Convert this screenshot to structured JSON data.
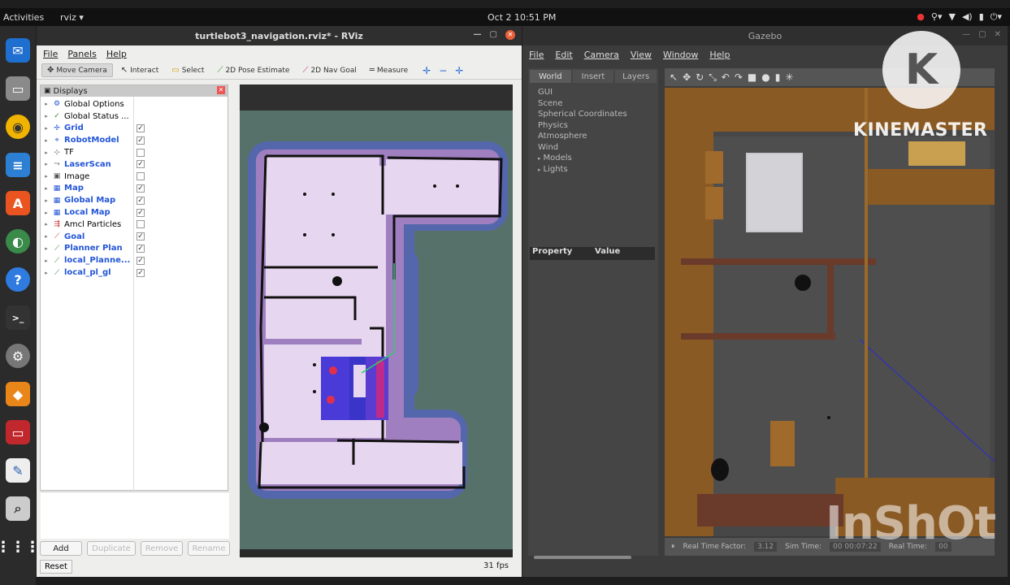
{
  "topbar": {
    "activities": "Activities",
    "app_menu": "rviz ▾",
    "clock": "Oct 2  10:51 PM"
  },
  "dock": {
    "items": [
      {
        "name": "thunderbird"
      },
      {
        "name": "files"
      },
      {
        "name": "rhythmbox"
      },
      {
        "name": "libreoffice-writer"
      },
      {
        "name": "software-center"
      },
      {
        "name": "chromium"
      },
      {
        "name": "help"
      },
      {
        "name": "terminal"
      },
      {
        "name": "settings"
      },
      {
        "name": "layers-app"
      },
      {
        "name": "system-monitor"
      },
      {
        "name": "text-editor"
      },
      {
        "name": "image-viewer"
      },
      {
        "name": "show-applications"
      }
    ]
  },
  "rviz": {
    "title": "turtlebot3_navigation.rviz* - RViz",
    "menu": [
      "File",
      "Panels",
      "Help"
    ],
    "toolbar": [
      "Move Camera",
      "Interact",
      "Select",
      "2D Pose Estimate",
      "2D Nav Goal",
      "Measure"
    ],
    "panel_title": "Displays",
    "displays": [
      {
        "label": "Global Options",
        "icon": "gear",
        "checked": null,
        "blue": false,
        "color": "#2255d8"
      },
      {
        "label": "Global Status ...",
        "icon": "check",
        "checked": null,
        "blue": false,
        "color": "#3a8a2a"
      },
      {
        "label": "Grid",
        "icon": "grid",
        "checked": true,
        "blue": true,
        "color": "#2255d8"
      },
      {
        "label": "RobotModel",
        "icon": "robot",
        "checked": true,
        "blue": true,
        "color": "#2255d8"
      },
      {
        "label": "TF",
        "icon": "tf",
        "checked": false,
        "blue": false,
        "color": "#555"
      },
      {
        "label": "LaserScan",
        "icon": "laser",
        "checked": true,
        "blue": true,
        "color": "#555"
      },
      {
        "label": "Image",
        "icon": "image",
        "checked": false,
        "blue": false,
        "color": "#555"
      },
      {
        "label": "Map",
        "icon": "map",
        "checked": true,
        "blue": true,
        "color": "#2255d8"
      },
      {
        "label": "Global Map",
        "icon": "map",
        "checked": true,
        "blue": true,
        "color": "#2255d8"
      },
      {
        "label": "Local Map",
        "icon": "map",
        "checked": true,
        "blue": true,
        "color": "#2255d8"
      },
      {
        "label": "Amcl Particles",
        "icon": "arrows",
        "checked": false,
        "blue": false,
        "color": "#c33"
      },
      {
        "label": "Goal",
        "icon": "goal",
        "checked": true,
        "blue": true,
        "color": "#c33"
      },
      {
        "label": "Planner Plan",
        "icon": "path",
        "checked": true,
        "blue": true,
        "color": "#2a8a2a"
      },
      {
        "label": "local_Planne...",
        "icon": "path",
        "checked": true,
        "blue": true,
        "color": "#2a8a2a"
      },
      {
        "label": "local_pl_gl",
        "icon": "path",
        "checked": true,
        "blue": true,
        "color": "#2a8a2a"
      }
    ],
    "buttons": {
      "add": "Add",
      "duplicate": "Duplicate",
      "remove": "Remove",
      "rename": "Rename"
    },
    "reset": "Reset",
    "fps": "31 fps"
  },
  "gazebo": {
    "title": "Gazebo",
    "menu": [
      "File",
      "Edit",
      "Camera",
      "View",
      "Window",
      "Help"
    ],
    "tabs": [
      "World",
      "Insert",
      "Layers"
    ],
    "tree": [
      "GUI",
      "Scene",
      "Spherical Coordinates",
      "Physics",
      "Atmosphere",
      "Wind",
      "Models",
      "Lights"
    ],
    "tree_expandable": [
      false,
      false,
      false,
      false,
      false,
      false,
      true,
      true
    ],
    "property_header": "Property",
    "value_header": "Value",
    "status": {
      "real_time_factor_label": "Real Time Factor:",
      "real_time_factor": "3.12",
      "sim_time_label": "Sim Time:",
      "sim_time": "00 00:07:22",
      "real_time_label": "Real Time:",
      "real_time": "00"
    }
  },
  "watermarks": {
    "kinemaster": "KINEMASTER",
    "kinemaster_logo": "K",
    "inshot": "InShOt"
  }
}
